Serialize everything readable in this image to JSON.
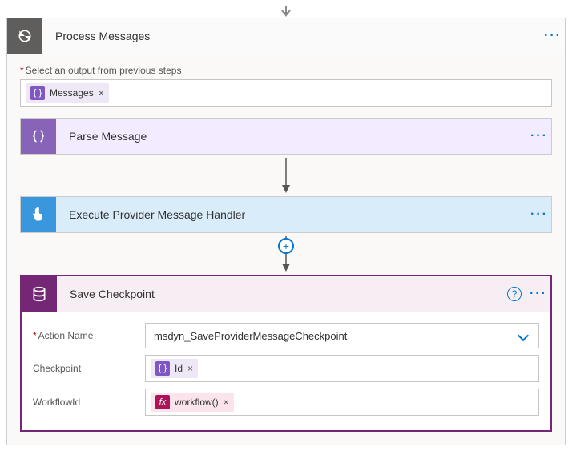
{
  "process": {
    "title": "Process Messages",
    "output_label": "Select an output from previous steps",
    "output_token": "Messages",
    "remove": "×"
  },
  "parse": {
    "title": "Parse Message"
  },
  "execute": {
    "title": "Execute Provider Message Handler"
  },
  "save": {
    "title": "Save Checkpoint",
    "action_name_label": "Action Name",
    "action_name_value": "msdyn_SaveProviderMessageCheckpoint",
    "checkpoint_label": "Checkpoint",
    "checkpoint_token": "Id",
    "workflow_label": "WorkflowId",
    "workflow_token_prefix": "fx",
    "workflow_token": "workflow()"
  },
  "menu": "···",
  "help": "?",
  "add": "+"
}
